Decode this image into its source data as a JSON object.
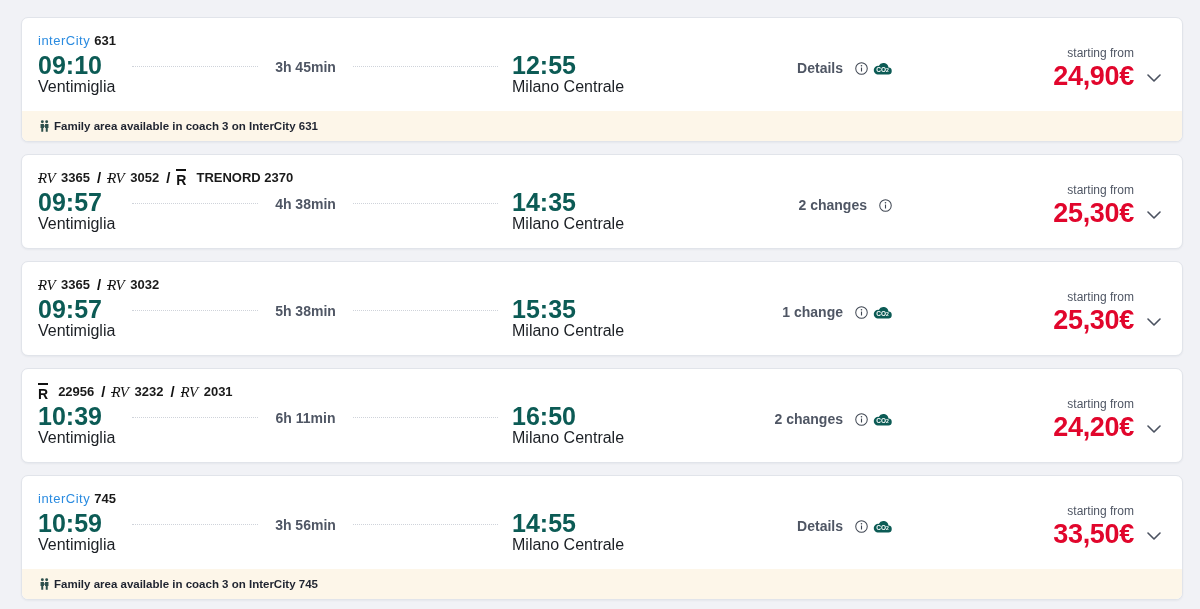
{
  "trips": [
    {
      "train": [
        {
          "kind": "intercity",
          "brand": "interCity",
          "number": "631"
        }
      ],
      "departure": {
        "time": "09:10",
        "station": "Ventimiglia"
      },
      "duration": "3h 45min",
      "arrival": {
        "time": "12:55",
        "station": "Milano Centrale"
      },
      "info": "Details",
      "eco_badge": "CO$_{2}$",
      "price_caption": "starting from",
      "price": "24,90€",
      "expanded": false,
      "notice": "Family area available in coach 3 on InterCity 631"
    },
    {
      "train": [
        {
          "kind": "rv",
          "brand": "RV",
          "number": "3365"
        },
        {
          "kind": "separator",
          "text": "/"
        },
        {
          "kind": "rv",
          "brand": "RV",
          "number": "3052"
        },
        {
          "kind": "separator",
          "text": "/"
        },
        {
          "kind": "regionale",
          "brand": "R",
          "number": "TRENORD 2370"
        }
      ],
      "departure": {
        "time": "09:57",
        "station": "Ventimiglia"
      },
      "duration": "4h 38min",
      "arrival": {
        "time": "14:35",
        "station": "Milano Centrale"
      },
      "info": "2 changes",
      "price_caption": "starting from",
      "price": "25,30€",
      "expanded": false
    },
    {
      "train": [
        {
          "kind": "rv",
          "brand": "RV",
          "number": "3365"
        },
        {
          "kind": "separator",
          "text": "/"
        },
        {
          "kind": "rv",
          "brand": "RV",
          "number": "3032"
        }
      ],
      "departure": {
        "time": "09:57",
        "station": "Ventimiglia"
      },
      "duration": "5h 38min",
      "arrival": {
        "time": "15:35",
        "station": "Milano Centrale"
      },
      "info": "1 change",
      "eco_badge": "CO$_{2}$",
      "price_caption": "starting from",
      "price": "25,30€",
      "expanded": false
    },
    {
      "train": [
        {
          "kind": "regionale",
          "brand": "R",
          "number": "22956"
        },
        {
          "kind": "separator",
          "text": "/"
        },
        {
          "kind": "rv",
          "brand": "RV",
          "number": "3232"
        },
        {
          "kind": "separator",
          "text": "/"
        },
        {
          "kind": "rv",
          "brand": "RV",
          "number": "2031"
        }
      ],
      "departure": {
        "time": "10:39",
        "station": "Ventimiglia"
      },
      "duration": "6h 11min",
      "arrival": {
        "time": "16:50",
        "station": "Milano Centrale"
      },
      "info": "2 changes",
      "eco_badge": "CO$_{2}$",
      "price_caption": "starting from",
      "price": "24,20€",
      "expanded": false
    },
    {
      "train": [
        {
          "kind": "intercity",
          "brand": "interCity",
          "number": "745"
        }
      ],
      "departure": {
        "time": "10:59",
        "station": "Ventimiglia"
      },
      "duration": "3h 56min",
      "arrival": {
        "time": "14:55",
        "station": "Milano Centrale"
      },
      "info": "Details",
      "eco_badge": "CO$_{2}$",
      "price_caption": "starting from",
      "price": "33,50€",
      "expanded": false,
      "notice": "Family area available in coach 3 on InterCity 745"
    }
  ]
}
